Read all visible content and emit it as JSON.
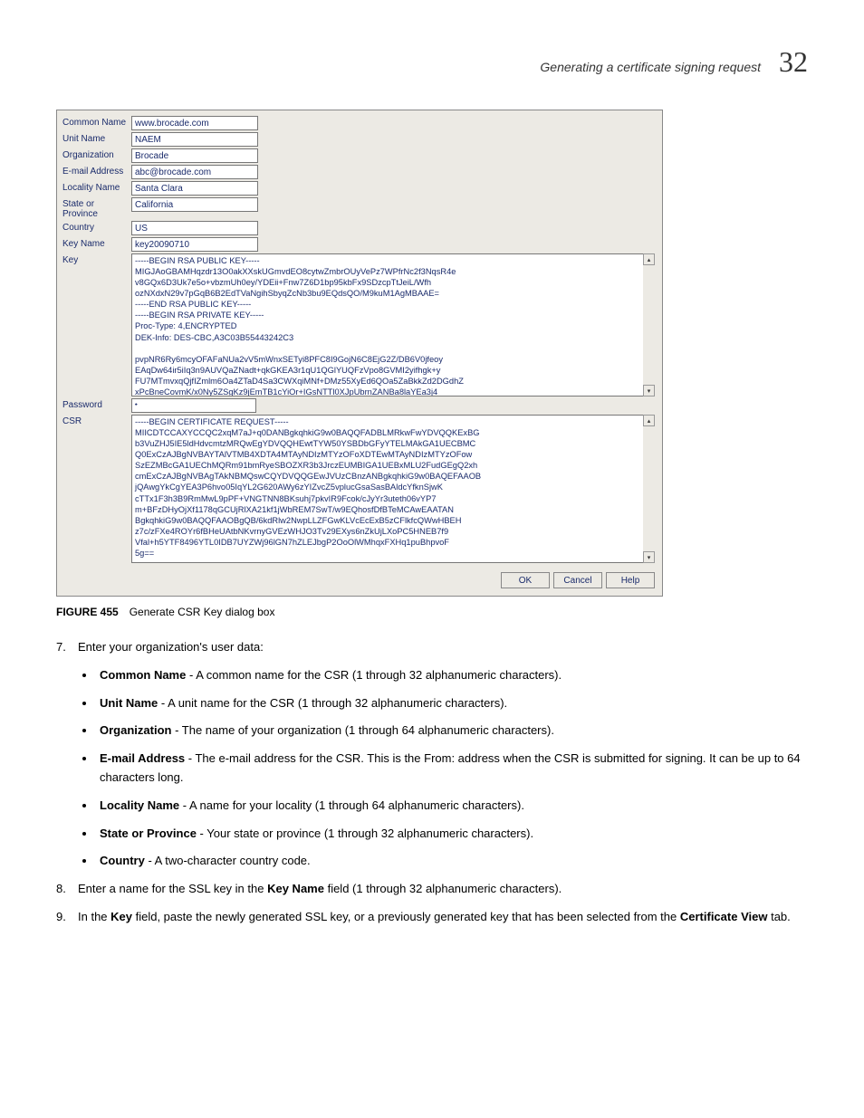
{
  "header": {
    "title": "Generating a certificate signing request",
    "chapter": "32"
  },
  "dialog": {
    "rows": {
      "common_name": {
        "label": "Common Name",
        "value": "www.brocade.com"
      },
      "unit_name": {
        "label": "Unit Name",
        "value": "NAEM"
      },
      "organization": {
        "label": "Organization",
        "value": "Brocade"
      },
      "email": {
        "label": "E-mail Address",
        "value": "abc@brocade.com"
      },
      "locality": {
        "label": "Locality Name",
        "value": "Santa Clara"
      },
      "state": {
        "label": "State or Province",
        "value": "California"
      },
      "country": {
        "label": "Country",
        "value": "US"
      },
      "key_name": {
        "label": "Key Name",
        "value": "key20090710"
      },
      "key": {
        "label": "Key",
        "value": "-----BEGIN RSA PUBLIC KEY-----\nMIGJAoGBAMHqzdr13O0akXXskUGmvdEO8cytwZmbrOUyVePz7WPfrNc2f3NqsR4e\nv8GQx6D3Uk7e5o+vbzmUh0ey/YDEii+Fnw7Z6D1bp95kbFx9SDzcpTtJeiL/Wfh\nozNXdxN29v7pGqB6B2EdTVaNgihSbyqZcNb3bu9EQdsQO/M9kuM1AgMBAAE=\n-----END RSA PUBLIC KEY-----\n-----BEGIN RSA PRIVATE KEY-----\nProc-Type: 4,ENCRYPTED\nDEK-Info: DES-CBC,A3C03B55443242C3\n\npvpNR6Ry6mcyOFAFaNUa2vV5mWnxSETyi8PFC8I9GojN6C8EjG2Z/DB6V0jfeoy\nEAqDw64ir5iIq3n9AUVQaZNadt+qkGKEA3r1qU1QGlYUQFzVpo8GVMI2yifhgk+y\nFU7MTmvxqQjfIZmlm6Oa4ZTaD4Sa3CWXqiMNf+DMz55XyEd6QOa5ZaBkkZd2DGdhZ\nxPcBneCovmK/x0Ny5ZSgKz9jEmTB1cYiOr+IGsNTTl0XJpUbrnZANBa8laYEa3j4"
      },
      "password": {
        "label": "Password",
        "value": "••••••"
      },
      "csr": {
        "label": "CSR",
        "value": "-----BEGIN CERTIFICATE REQUEST-----\nMIICDTCCAXYCCQC2xqM7aJ+q0DANBgkqhkiG9w0BAQQFADBLMRkwFwYDVQQKExBG\nb3VuZHJ5IE5ldHdvcmtzMRQwEgYDVQQHEwtTYW50YSBDbGFyYTELMAkGA1UECBMC\nQ0ExCzAJBgNVBAYTAlVTMB4XDTA4MTAyNDIzMTYzOFoXDTEwMTAyNDIzMTYzOFow\nSzEZMBcGA1UEChMQRm91bmRyeSBOZXR3b3JrczEUMBIGA1UEBxMLU2FudGEgQ2xh\ncmExCzAJBgNVBAgTAkNBMQswCQYDVQQGEwJVUzCBnzANBgkqhkiG9w0BAQEFAAOB\njQAwgYkCgYEA3P6hvo05IqYL2G620AWy6zYIZvcZ5vplucGsaSasBAldcYfknSjwK\ncTTx1F3h3B9RmMwL9pPF+VNGTNN8BKsuhj7pkvIR9Fcok/cJyYr3uteth06vYP7\nm+BFzDHyOjXf1178qGCUjRlXA21kf1jWbREM7SwT/w9EQhosfDfBTeMCAwEAATAN\nBgkqhkiG9w0BAQQFAAOBgQB/6kdRlw2NwpLLZFGwKLVcEcExB5zCFlkfcQWwHBEH\nz7c/zFXe4ROYr6fBHeUAtbNKvrnyGVEzWHJO3Tv29EXys6nZkUjLXoPC5HNEB7f9\nVfal+h5YTF8496YTL0IDB7UYZWj96lGN7hZLEJbgP2OoOlWMhqxFXHq1puBhpvoF\n5g=="
      }
    },
    "buttons": {
      "ok": "OK",
      "cancel": "Cancel",
      "help": "Help"
    }
  },
  "caption": {
    "label": "FIGURE 455",
    "text": "Generate CSR Key dialog box"
  },
  "body": {
    "step7": {
      "num": "7.",
      "intro": "Enter your organization's user data:",
      "bullets": [
        {
          "term": "Common Name",
          "text": " - A common name for the CSR (1 through 32 alphanumeric characters)."
        },
        {
          "term": "Unit Name",
          "text": " - A unit name for the CSR (1 through 32 alphanumeric characters)."
        },
        {
          "term": "Organization",
          "text": " - The name of your organization (1 through 64 alphanumeric characters)."
        },
        {
          "term": "E-mail Address",
          "text": " - The e-mail address for the CSR. This is the From: address when the CSR is submitted for signing. It can be up to 64 characters long."
        },
        {
          "term": "Locality Name",
          "text": " - A name for your locality (1 through 64 alphanumeric characters)."
        },
        {
          "term": "State or Province",
          "text": " - Your state or province (1 through 32 alphanumeric characters)."
        },
        {
          "term": "Country",
          "text": " - A two-character country code."
        }
      ]
    },
    "step8": {
      "num": "8.",
      "pre": "Enter a name for the SSL key in the ",
      "term": "Key Name",
      "post": " field (1 through 32 alphanumeric characters)."
    },
    "step9": {
      "num": "9.",
      "pre": "In the ",
      "term1": "Key",
      "mid": " field, paste the newly generated SSL key, or a previously generated key that has been selected from the ",
      "term2": "Certificate View",
      "post": " tab."
    }
  }
}
